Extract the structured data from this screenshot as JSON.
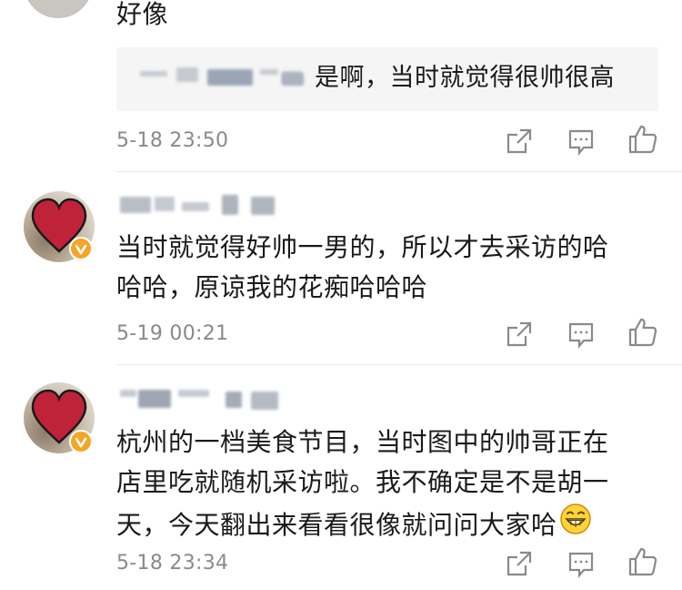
{
  "comments": [
    {
      "text": "好像",
      "reply_quote": "是啊，当时就觉得很帅很高",
      "time": "5-18 23:50"
    },
    {
      "text_line1": "当时就觉得好帅一男的，所以才去采访的哈",
      "text_line2": "哈哈，原谅我的花痴哈哈哈",
      "time": "5-19 00:21"
    },
    {
      "text_line1": "杭州的一档美食节目，当时图中的帅哥正在",
      "text_line2": "店里吃就随机采访啦。我不确定是不是胡一",
      "text_line3": "天，今天翻出来看看很像就问问大家哈",
      "time": "5-18 23:34"
    }
  ],
  "colors": {
    "text": "#1a1a1a",
    "meta": "#8a8a8a",
    "quote_bg": "#f5f5f5",
    "verified_badge": "#f5a623",
    "heart": "#c0223a"
  },
  "icons": [
    "share-icon",
    "comment-icon",
    "like-icon",
    "grin-emoji-icon",
    "verified-badge-icon"
  ]
}
